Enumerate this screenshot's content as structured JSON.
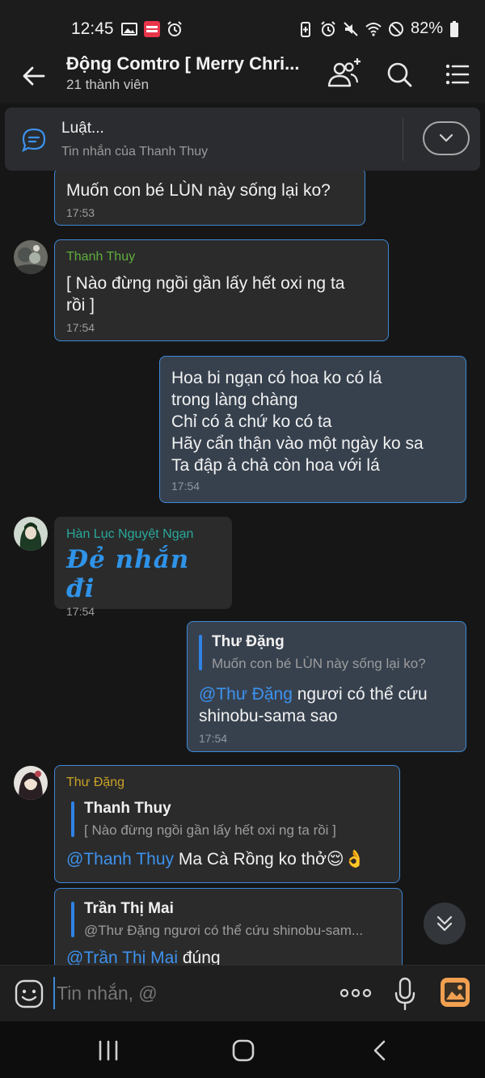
{
  "status_bar": {
    "time": "12:45",
    "battery": "82%",
    "icons_left": [
      "image-icon",
      "manga-toon-app-icon",
      "alarm-icon"
    ],
    "icons_right": [
      "battery-saver-icon",
      "alarm-icon",
      "mute-icon",
      "wifi-icon",
      "do-not-disturb-icon",
      "battery-icon"
    ]
  },
  "header": {
    "title": "Động Comtro [ Merry Christmas ]",
    "title_display": "Động Comtro [ Merry Chri...",
    "subtitle": "21 thành viên"
  },
  "pinned": {
    "title": "Luật...",
    "subtitle": "Tin nhắn của Thanh Thuy"
  },
  "messages": [
    {
      "text": "Muốn con bé LÙN này sống lại ko?",
      "time": "17:53"
    },
    {
      "sender": "Thanh Thuy",
      "text": "[ Nào đừng ngồi gần lấy hết oxi ng ta\nrồi ]",
      "time": "17:54"
    },
    {
      "text": "Hoa bi ngạn có hoa ko có lá\ntrong làng chàng\nChỉ có ả chứ ko có ta\nHãy cẩn thận vào một ngày ko sa\nTa đập ả chả còn hoa với lá",
      "time": "17:54"
    },
    {
      "sender": "Hàn Lục Nguyệt Ngạn",
      "text": "Đẻ nhắn đi",
      "time": "17:54"
    },
    {
      "quote_name": "Thư Đặng",
      "quote_text": "Muốn con bé LÙN này sống lại ko?",
      "mention": "@Thư Đặng",
      "text": " ngươi có thể cứu\nshinobu-sama sao",
      "time": "17:54"
    },
    {
      "sender": "Thư Đặng",
      "quote_name": "Thanh Thuy",
      "quote_text": "[ Nào đừng ngồi gần lấy hết oxi ng ta rồi ]",
      "mention": "@Thanh Thuy",
      "text": " Ma Cà Rồng ko thở",
      "emoji": "😌👌"
    },
    {
      "quote_name": "Trần Thị Mai",
      "quote_text": "@Thư Đặng ngươi có thể cứu shinobu-sam...",
      "mention": "@Trần Thị Mai",
      "text": " đúng"
    }
  ],
  "composer": {
    "placeholder": "Tin nhắn, @"
  },
  "colors": {
    "accent": "#3d88d6",
    "sender_thanh_thuy": "#5fae3c",
    "sender_han_luc": "#28a99a",
    "sender_thu_dang": "#c9a227",
    "outgoing_bubble": "#37414e",
    "incoming_bubble": "#2b2b2b"
  }
}
